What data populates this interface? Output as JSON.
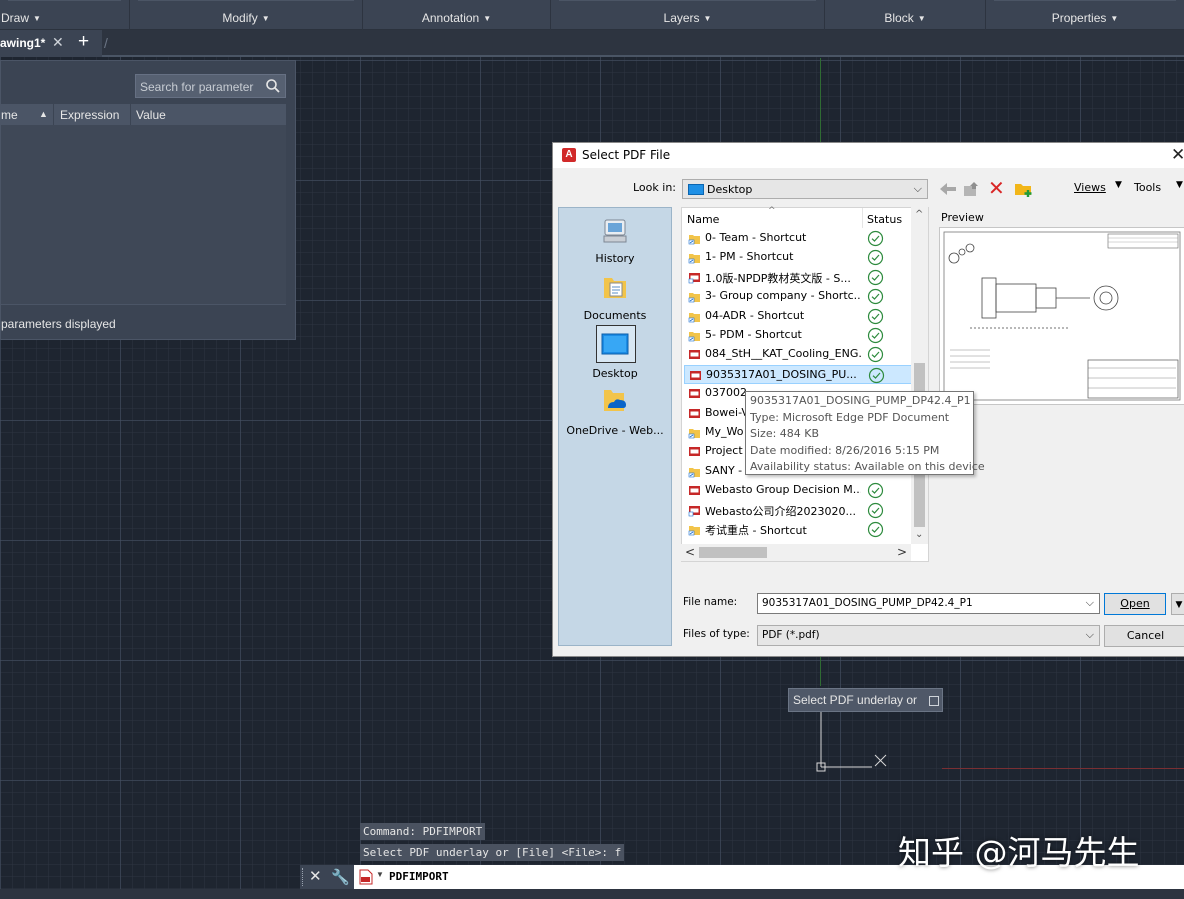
{
  "ribbon": {
    "panels": [
      {
        "label": "Draw"
      },
      {
        "label": "Modify"
      },
      {
        "label": "Annotation"
      },
      {
        "label": "Layers"
      },
      {
        "label": "Block"
      },
      {
        "label": "Properties"
      }
    ]
  },
  "tabs": {
    "active_label": "awing1*",
    "close_glyph": "✕",
    "new_glyph": "+"
  },
  "parameters": {
    "search_placeholder": "Search for parameter",
    "columns": [
      "me",
      "Expression",
      "Value"
    ],
    "status": "parameters displayed"
  },
  "dialog": {
    "title": "Select PDF File",
    "look_in_label": "Look in:",
    "look_in_value": "Desktop",
    "views_label": "Views",
    "tools_label": "Tools",
    "places": [
      {
        "label": "History",
        "icon": "history-icon"
      },
      {
        "label": "Documents",
        "icon": "documents-icon"
      },
      {
        "label": "Desktop",
        "icon": "desktop-icon"
      },
      {
        "label": "OneDrive - Web...",
        "icon": "onedrive-icon"
      }
    ],
    "columns": {
      "name": "Name",
      "status": "Status"
    },
    "files": [
      {
        "name": "0- Team - Shortcut",
        "type": "shortcut"
      },
      {
        "name": "1- PM - Shortcut",
        "type": "shortcut"
      },
      {
        "name": "1.0版-NPDP教材英文版 - S...",
        "type": "pdf-shortcut"
      },
      {
        "name": "3- Group company - Shortc...",
        "type": "shortcut"
      },
      {
        "name": "04-ADR - Shortcut",
        "type": "shortcut"
      },
      {
        "name": "5- PDM - Shortcut",
        "type": "shortcut"
      },
      {
        "name": "084_StH__KAT_Cooling_ENG...",
        "type": "pdf"
      },
      {
        "name": "9035317A01_DOSING_PU...",
        "type": "pdf"
      },
      {
        "name": "037002",
        "type": "pdf"
      },
      {
        "name": "Bowei-V",
        "type": "pdf"
      },
      {
        "name": "My_Wo",
        "type": "shortcut"
      },
      {
        "name": "Project",
        "type": "pdf"
      },
      {
        "name": "SANY -",
        "type": "shortcut"
      },
      {
        "name": "Webasto Group Decision M...",
        "type": "pdf"
      },
      {
        "name": "Webasto公司介绍2023020...",
        "type": "pdf-shortcut"
      },
      {
        "name": "考试重点 - Shortcut",
        "type": "shortcut"
      }
    ],
    "selected_index": 7,
    "preview_label": "Preview",
    "tooltip": [
      "9035317A01_DOSING_PUMP_DP42.4_P1",
      "Type: Microsoft Edge PDF Document",
      "Size: 484 KB",
      "Date modified: 8/26/2016 5:15 PM",
      "Availability status: Available on this device"
    ],
    "file_name_label": "File name:",
    "file_name_value": "9035317A01_DOSING_PUMP_DP42.4_P1",
    "file_type_label": "Files of type:",
    "file_type_value": "PDF (*.pdf)",
    "open_label": "Open",
    "cancel_label": "Cancel"
  },
  "canvas": {
    "prompt_tip": "Select PDF underlay or"
  },
  "command": {
    "history": [
      "Command: PDFIMPORT",
      "Select PDF underlay or [File] <File>: f"
    ],
    "current": "PDFIMPORT"
  },
  "watermark": "知乎 @河马先生",
  "colors": {
    "canvas_bg": "#1e2530",
    "ribbon_bg": "#3b4453",
    "selection": "#cce8ff",
    "status_ok": "#2e8b3e"
  }
}
